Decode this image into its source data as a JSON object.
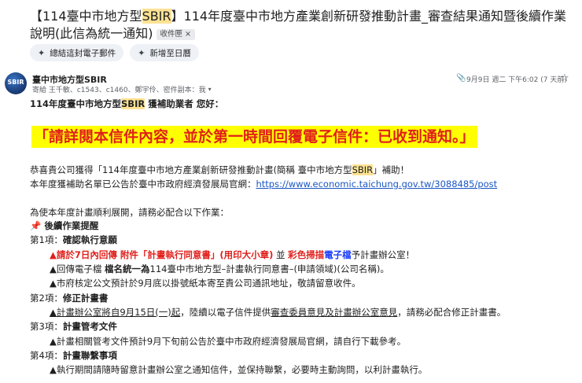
{
  "subject": {
    "part1": "【114臺中市地方型",
    "sbir": "SBIR",
    "part2": "】114年度臺中市地方產業創新研發推動計畫_審查結果通知暨後續作業說明(此信為統一通知)",
    "label_chip": "收件匣 ×"
  },
  "actions": {
    "summarize": "總結這封電子郵件",
    "add_to_calendar": "新增至日曆"
  },
  "header": {
    "avatar_text": "SBIR",
    "sender": "臺中市地方型SBIR",
    "recipients": "寄給 王千敏、c1543、c1460、鄭宇伶、密件副本：我",
    "date": "9月9日 週二 下午6:02 (7 天前)"
  },
  "body": {
    "greet_a": "114年度臺中市地方型",
    "greet_sbir": "SBIR",
    "greet_b": " 獲補助業者 您好：",
    "notice": "「請詳閱本信件內容，並於第一時間回覆電子信件：已收到通知。」",
    "congrats_a": "恭喜貴公司獲得「114年度臺中市地方產業創新研發推動計畫(簡稱 臺中市地方型",
    "congrats_sbir": "SBIR",
    "congrats_b": "」補助！",
    "list_a": "本年度獲補助名單已公告於臺中市政府經濟發展局官網：",
    "list_url": "https://www.economic.taichung.gov.tw/3088485/post",
    "intro": "為使本年度計畫順利展開，請務必配合以下作業：",
    "followup_title": "後續作業提醒",
    "item1_a": "第1項：",
    "item1_b": "確認執行意願",
    "i1l1_red": "▲請於7日內回傳 附件「計畫執行同意書」(用印大小章)",
    "i1l1_mid": " 並 ",
    "i1l1_red2": "彩色掃描",
    "i1l1_blue": "電子檔",
    "i1l1_end": "予計畫辦公室！",
    "i1l2_a": "▲回傳電子檔 ",
    "i1l2_b": "檔名統一為",
    "i1l2_c": "114臺中市地方型–計畫執行同意書–(申請領域)(公司名稱)。",
    "i1l3": "▲市府核定公文預計於9月底以掛號紙本寄至貴公司通訊地址，敬請留意收件。",
    "item2_a": "第2項：",
    "item2_b": "修正計畫書",
    "i2l1_a": "▲計畫辦公室將自9月15日(一)起",
    "i2l1_b": "，陸續以電子信件提供",
    "i2l1_c": "審查委員意見及計畫辦公室意見",
    "i2l1_d": "，請務必配合修正計畫書。",
    "item3_a": "第3項：",
    "item3_b": "計畫管考文件",
    "i3l1": "▲計畫相關管考文件預計9月下旬前公告於臺中市政府經濟發展局官網，請自行下載參考。",
    "item4_a": "第4項：",
    "item4_b": "計畫聯繫事項",
    "i4l1": "▲執行期間請隨時留意計畫辦公室之通知信件，並保持聯繫，必要時主動詢問，以利計畫執行。"
  }
}
